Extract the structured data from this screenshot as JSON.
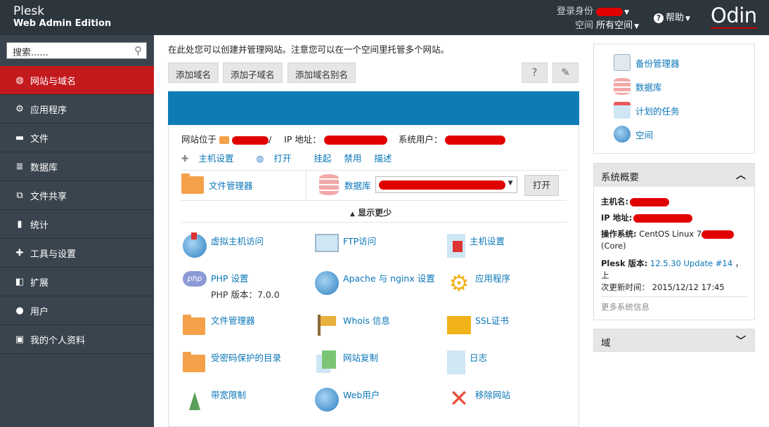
{
  "brand": {
    "name": "Plesk",
    "edition": "Web Admin Edition"
  },
  "topbar": {
    "login_label": "登录身份",
    "space_label": "空间",
    "space_value": "所有空间",
    "help_label": "帮助",
    "logo": "Odin"
  },
  "sidebar": {
    "search_placeholder": "搜索......",
    "items": [
      {
        "label": "网站与域名",
        "icon": "globe-icon"
      },
      {
        "label": "应用程序",
        "icon": "gear-icon"
      },
      {
        "label": "文件",
        "icon": "folder-icon"
      },
      {
        "label": "数据库",
        "icon": "database-icon"
      },
      {
        "label": "文件共享",
        "icon": "share-icon"
      },
      {
        "label": "统计",
        "icon": "bar-chart-icon"
      },
      {
        "label": "工具与设置",
        "icon": "tools-icon"
      },
      {
        "label": "扩展",
        "icon": "puzzle-icon"
      },
      {
        "label": "用户",
        "icon": "user-icon"
      },
      {
        "label": "我的个人资料",
        "icon": "profile-icon"
      }
    ]
  },
  "main": {
    "intro": "在此处您可以创建并管理网站。注意您可以在一个空间里托管多个网站。",
    "buttons": {
      "add_domain": "添加域名",
      "add_subdomain": "添加子域名",
      "add_alias": "添加域名别名"
    },
    "site_info": {
      "site_at": "网站位于",
      "ip_label": "IP 地址：",
      "sys_user": "系统用户："
    },
    "actions": [
      "主机设置",
      "打开",
      "挂起",
      "禁用",
      "描述"
    ],
    "file_manager": "文件管理器",
    "database": "数据库",
    "open_btn": "打开",
    "show_less": "显示更少",
    "tiles": [
      {
        "label": "虚拟主机访问",
        "icon": "vhost-icon"
      },
      {
        "label": "FTP访问",
        "icon": "ftp-icon"
      },
      {
        "label": "主机设置",
        "icon": "hosting-settings-icon"
      },
      {
        "label": "PHP 设置",
        "sub": "PHP 版本：7.0.0",
        "icon": "php-icon"
      },
      {
        "label": "Apache 与 nginx 设置",
        "icon": "apache-icon"
      },
      {
        "label": "应用程序",
        "icon": "applications-icon"
      },
      {
        "label": "文件管理器",
        "icon": "folder-icon"
      },
      {
        "label": "Whois 信息",
        "icon": "whois-icon"
      },
      {
        "label": "SSL证书",
        "icon": "ssl-icon"
      },
      {
        "label": "受密码保护的目录",
        "icon": "protected-folder-icon"
      },
      {
        "label": "网站复制",
        "icon": "copy-icon"
      },
      {
        "label": "日志",
        "icon": "logs-icon"
      },
      {
        "label": "带宽限制",
        "icon": "bandwidth-icon"
      },
      {
        "label": "Web用户",
        "icon": "web-users-icon"
      },
      {
        "label": "移除网站",
        "icon": "remove-icon"
      }
    ]
  },
  "right": {
    "links": [
      {
        "label": "备份管理器",
        "icon": "backup-icon"
      },
      {
        "label": "数据库",
        "icon": "database-icon"
      },
      {
        "label": "计划的任务",
        "icon": "calendar-icon"
      },
      {
        "label": "空间",
        "icon": "space-icon"
      }
    ],
    "overview": {
      "title": "系统概要",
      "hostname_label": "主机名:",
      "ip_label": "IP 地址:",
      "os_label": "操作系统:",
      "os_value": "CentOS Linux 7",
      "os_value2": "(Core)",
      "version_label": "Plesk 版本:",
      "version_link": "12.5.30 Update #14",
      "version_tail": "，上",
      "updated_label": "次更新时间：",
      "updated_value": "2015/12/12 17:45",
      "more": "更多系统信息"
    },
    "domain_title": "域"
  }
}
